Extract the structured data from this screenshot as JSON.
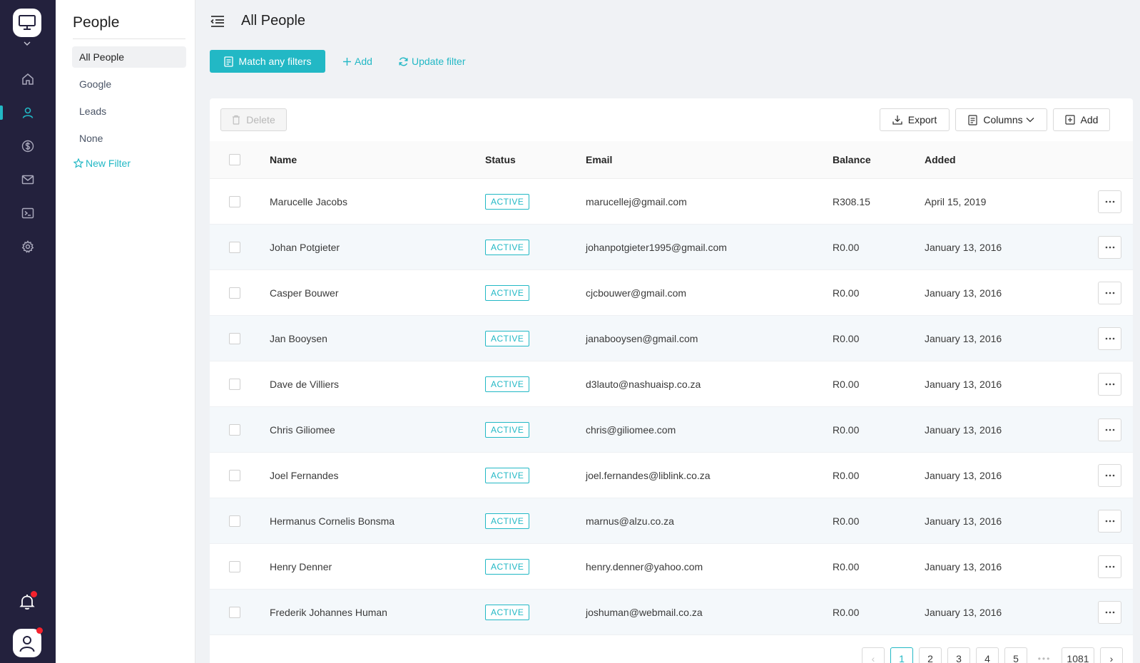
{
  "side_panel": {
    "title": "People",
    "items": [
      "All People",
      "Google",
      "Leads",
      "None"
    ],
    "new_filter_label": "New Filter"
  },
  "header": {
    "title": "All People"
  },
  "filter_bar": {
    "match_label": "Match any filters",
    "add_label": "Add",
    "update_label": "Update filter"
  },
  "toolbar": {
    "delete_label": "Delete",
    "export_label": "Export",
    "columns_label": "Columns",
    "add_label": "Add"
  },
  "table": {
    "columns": [
      "Name",
      "Status",
      "Email",
      "Balance",
      "Added"
    ],
    "rows": [
      {
        "name": "Marucelle Jacobs",
        "status": "ACTIVE",
        "email": "marucellej@gmail.com",
        "balance": "R308.15",
        "added": "April 15, 2019"
      },
      {
        "name": "Johan Potgieter",
        "status": "ACTIVE",
        "email": "johanpotgieter1995@gmail.com",
        "balance": "R0.00",
        "added": "January 13, 2016"
      },
      {
        "name": "Casper Bouwer",
        "status": "ACTIVE",
        "email": "cjcbouwer@gmail.com",
        "balance": "R0.00",
        "added": "January 13, 2016"
      },
      {
        "name": "Jan Booysen",
        "status": "ACTIVE",
        "email": "janabooysen@gmail.com",
        "balance": "R0.00",
        "added": "January 13, 2016"
      },
      {
        "name": "Dave de Villiers",
        "status": "ACTIVE",
        "email": "d3lauto@nashuaisp.co.za",
        "balance": "R0.00",
        "added": "January 13, 2016"
      },
      {
        "name": "Chris Giliomee",
        "status": "ACTIVE",
        "email": "chris@giliomee.com",
        "balance": "R0.00",
        "added": "January 13, 2016"
      },
      {
        "name": "Joel Fernandes",
        "status": "ACTIVE",
        "email": "joel.fernandes@liblink.co.za",
        "balance": "R0.00",
        "added": "January 13, 2016"
      },
      {
        "name": "Hermanus Cornelis Bonsma",
        "status": "ACTIVE",
        "email": "marnus@alzu.co.za",
        "balance": "R0.00",
        "added": "January 13, 2016"
      },
      {
        "name": "Henry Denner",
        "status": "ACTIVE",
        "email": "henry.denner@yahoo.com",
        "balance": "R0.00",
        "added": "January 13, 2016"
      },
      {
        "name": "Frederik Johannes Human",
        "status": "ACTIVE",
        "email": "joshuman@webmail.co.za",
        "balance": "R0.00",
        "added": "January 13, 2016"
      }
    ]
  },
  "pagination": {
    "prev_glyph": "‹",
    "pages": [
      "1",
      "2",
      "3",
      "4",
      "5"
    ],
    "ellipsis": "•••",
    "last_page": "1081",
    "next_glyph": "›",
    "current": "1"
  },
  "colors": {
    "accent": "#22b8c5",
    "rail": "#23213d",
    "alert": "#f5222d"
  },
  "icons": {
    "rail": [
      "monitor-icon",
      "chevron-down-icon",
      "home-icon",
      "user-icon",
      "dollar-icon",
      "mail-icon",
      "terminal-icon",
      "gear-icon",
      "bell-icon",
      "avatar-icon"
    ],
    "toolbar": [
      "trash-icon",
      "download-icon",
      "columns-icon",
      "plus-square-icon",
      "ellipsis-icon"
    ]
  }
}
